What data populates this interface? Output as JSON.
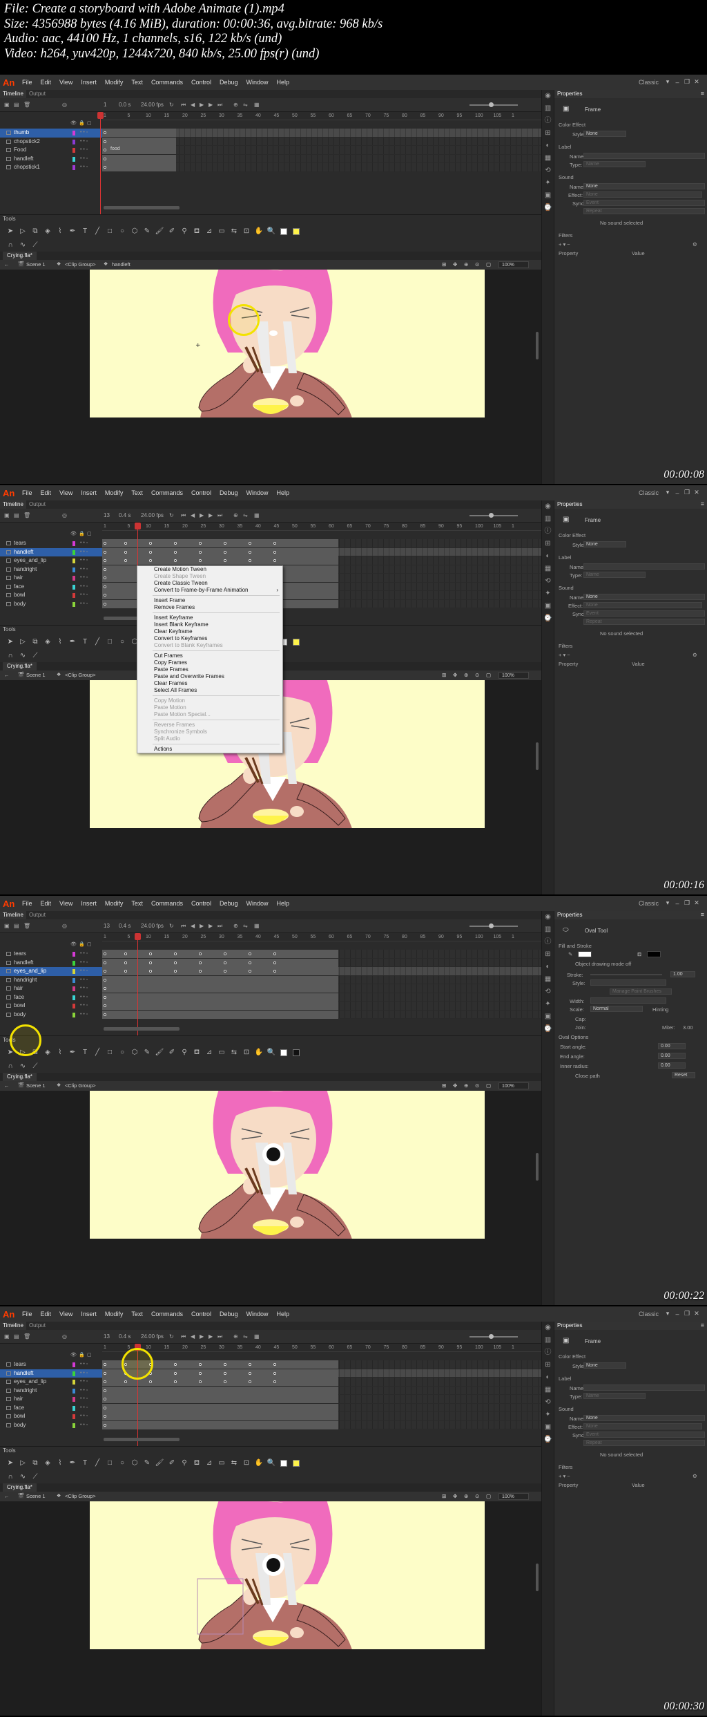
{
  "meta": {
    "file": "File: Create a storyboard with Adobe Animate (1).mp4",
    "size": "Size: 4356988 bytes (4.16 MiB), duration: 00:00:36, avg.bitrate: 968 kb/s",
    "audio": "Audio: aac, 44100 Hz, 1 channels, s16, 122 kb/s (und)",
    "video": "Video: h264, yuv420p, 1244x720, 840 kb/s, 25.00 fps(r) (und)"
  },
  "app": {
    "logo": "An",
    "menus": [
      "File",
      "Edit",
      "View",
      "Insert",
      "Modify",
      "Text",
      "Commands",
      "Control",
      "Debug",
      "Window",
      "Help"
    ],
    "workspace": "Classic",
    "panel_tabs": [
      "Timeline",
      "Output"
    ],
    "tools_title": "Tools",
    "properties_tab": "Properties",
    "colors": {
      "accent": "#2e5fa8",
      "logo": "#ff3c00",
      "highlight": "#f3e200",
      "stage": "#fdfdc8"
    }
  },
  "frames": [
    {
      "timestamp": "00:00:08",
      "fps": "24.00 fps",
      "frame_num": "1",
      "time": "0.0 s",
      "layers": [
        {
          "name": "thumb",
          "color": "#d43ad4",
          "selected": true
        },
        {
          "name": "chopstick2",
          "color": "#8a3ad4",
          "selected": false
        },
        {
          "name": "Food",
          "color": "#d43a3a",
          "selected": false
        },
        {
          "name": "handleft",
          "color": "#3ad4d4",
          "selected": false
        },
        {
          "name": "chopstick1",
          "color": "#a03ad4",
          "selected": false
        }
      ],
      "frame_label": "food",
      "doc_tab": "Crying.fla*",
      "breadcrumb": [
        "Scene 1",
        "<Clip Group>",
        "handleft"
      ],
      "zoom": "100%",
      "props_title": "Frame",
      "props": {
        "color_effect": "Color Effect",
        "style_label": "Style:",
        "style_value": "None",
        "label_section": "Label",
        "name_label": "Name:",
        "type_label": "Type:",
        "type_value": "Name",
        "sound_section": "Sound",
        "sound_name": "None",
        "effect_label": "Effect:",
        "effect_value": "None",
        "sync_label": "Sync:",
        "sync_value": "Event",
        "repeat_value": "Repeat",
        "no_sound": "No sound selected",
        "filters_section": "Filters",
        "property_col": "Property",
        "value_col": "Value"
      }
    },
    {
      "timestamp": "00:00:16",
      "fps": "24.00 fps",
      "frame_num": "13",
      "time": "0.4 s",
      "layers": [
        {
          "name": "tears",
          "color": "#d43ad4",
          "selected": false
        },
        {
          "name": "handleft",
          "color": "#3ad43a",
          "selected": true
        },
        {
          "name": "eyes_and_lip",
          "color": "#d4d43a",
          "selected": false
        },
        {
          "name": "handright",
          "color": "#3a8ad4",
          "selected": false
        },
        {
          "name": "hair",
          "color": "#d43a8a",
          "selected": false
        },
        {
          "name": "face",
          "color": "#3ad4d4",
          "selected": false
        },
        {
          "name": "bowl",
          "color": "#d43a3a",
          "selected": false
        },
        {
          "name": "body",
          "color": "#8ad43a",
          "selected": false
        }
      ],
      "doc_tab": "Crying.fla*",
      "breadcrumb": [
        "Scene 1",
        "<Clip Group>"
      ],
      "zoom": "100%",
      "props_title": "Frame",
      "context_menu": [
        {
          "label": "Create Motion Tween",
          "disabled": false
        },
        {
          "label": "Create Shape Tween",
          "disabled": true
        },
        {
          "label": "Create Classic Tween",
          "disabled": false
        },
        {
          "label": "Convert to Frame-by-Frame Animation",
          "disabled": false,
          "submenu": true
        },
        {
          "sep": true
        },
        {
          "label": "Insert Frame",
          "disabled": false
        },
        {
          "label": "Remove Frames",
          "disabled": false
        },
        {
          "sep": true
        },
        {
          "label": "Insert Keyframe",
          "disabled": false
        },
        {
          "label": "Insert Blank Keyframe",
          "disabled": false
        },
        {
          "label": "Clear Keyframe",
          "disabled": false
        },
        {
          "label": "Convert to Keyframes",
          "disabled": false
        },
        {
          "label": "Convert to Blank Keyframes",
          "disabled": true
        },
        {
          "sep": true
        },
        {
          "label": "Cut Frames",
          "disabled": false
        },
        {
          "label": "Copy Frames",
          "disabled": false
        },
        {
          "label": "Paste Frames",
          "disabled": false
        },
        {
          "label": "Paste and Overwrite Frames",
          "disabled": false
        },
        {
          "label": "Clear Frames",
          "disabled": false
        },
        {
          "label": "Select All Frames",
          "disabled": false
        },
        {
          "sep": true
        },
        {
          "label": "Copy Motion",
          "disabled": true
        },
        {
          "label": "Paste Motion",
          "disabled": true
        },
        {
          "label": "Paste Motion Special...",
          "disabled": true
        },
        {
          "sep": true
        },
        {
          "label": "Reverse Frames",
          "disabled": true
        },
        {
          "label": "Synchronize Symbols",
          "disabled": true
        },
        {
          "label": "Split Audio",
          "disabled": true
        },
        {
          "sep": true
        },
        {
          "label": "Actions",
          "disabled": false
        }
      ],
      "props": {
        "color_effect": "Color Effect",
        "style_label": "Style:",
        "style_value": "None",
        "label_section": "Label",
        "name_label": "Name:",
        "type_label": "Type:",
        "type_value": "Name",
        "sound_section": "Sound",
        "sound_name": "None",
        "effect_label": "Effect:",
        "effect_value": "None",
        "sync_label": "Sync:",
        "sync_value": "Event",
        "repeat_value": "Repeat",
        "no_sound": "No sound selected",
        "filters_section": "Filters",
        "property_col": "Property",
        "value_col": "Value"
      }
    },
    {
      "timestamp": "00:00:22",
      "fps": "24.00 fps",
      "frame_num": "13",
      "time": "0.4 s",
      "layers": [
        {
          "name": "tears",
          "color": "#d43ad4",
          "selected": false
        },
        {
          "name": "handleft",
          "color": "#3ad43a",
          "selected": false
        },
        {
          "name": "eyes_and_lip",
          "color": "#d4d43a",
          "selected": true
        },
        {
          "name": "handright",
          "color": "#3a8ad4",
          "selected": false
        },
        {
          "name": "hair",
          "color": "#d43a8a",
          "selected": false
        },
        {
          "name": "face",
          "color": "#3ad4d4",
          "selected": false
        },
        {
          "name": "bowl",
          "color": "#d43a3a",
          "selected": false
        },
        {
          "name": "body",
          "color": "#8ad43a",
          "selected": false
        }
      ],
      "doc_tab": "Crying.fla*",
      "breadcrumb": [
        "Scene 1",
        "<Clip Group>"
      ],
      "zoom": "100%",
      "props_title": "Oval Tool",
      "oval": {
        "fill_stroke": "Fill and Stroke",
        "object_drawing": "Object drawing mode off",
        "stroke_label": "Stroke:",
        "stroke_value": "1.00",
        "style_label": "Style:",
        "manage_brush": "Manage Paint Brushes",
        "width_label": "Width:",
        "scale_label": "Scale:",
        "scale_value": "Normal",
        "hinting": "Hinting",
        "cap_label": "Cap:",
        "join_label": "Join:",
        "miter_label": "Miter:",
        "miter_value": "3.00",
        "oval_options": "Oval Options",
        "start_angle": "Start angle:",
        "start_value": "0.00",
        "end_angle": "End angle:",
        "end_value": "0.00",
        "inner_radius": "Inner radius:",
        "inner_value": "0.00",
        "close_path": "Close path",
        "reset": "Reset"
      }
    },
    {
      "timestamp": "00:00:30",
      "fps": "24.00 fps",
      "frame_num": "13",
      "time": "0.4 s",
      "layers": [
        {
          "name": "tears",
          "color": "#d43ad4",
          "selected": false
        },
        {
          "name": "handleft",
          "color": "#3ad43a",
          "selected": true
        },
        {
          "name": "eyes_and_lip",
          "color": "#d4d43a",
          "selected": false
        },
        {
          "name": "handright",
          "color": "#3a8ad4",
          "selected": false
        },
        {
          "name": "hair",
          "color": "#d43a8a",
          "selected": false
        },
        {
          "name": "face",
          "color": "#3ad4d4",
          "selected": false
        },
        {
          "name": "bowl",
          "color": "#d43a3a",
          "selected": false
        },
        {
          "name": "body",
          "color": "#8ad43a",
          "selected": false
        }
      ],
      "doc_tab": "Crying.fla*",
      "breadcrumb": [
        "Scene 1",
        "<Clip Group>"
      ],
      "zoom": "100%",
      "props_title": "Frame",
      "props": {
        "color_effect": "Color Effect",
        "style_label": "Style:",
        "style_value": "None",
        "label_section": "Label",
        "name_label": "Name:",
        "type_label": "Type:",
        "type_value": "Name",
        "sound_section": "Sound",
        "sound_name": "None",
        "effect_label": "Effect:",
        "effect_value": "None",
        "sync_label": "Sync:",
        "sync_value": "Event",
        "repeat_value": "Repeat",
        "no_sound": "No sound selected",
        "filters_section": "Filters",
        "property_col": "Property",
        "value_col": "Value"
      }
    }
  ],
  "ruler_ticks": [
    "1",
    "5",
    "10",
    "15",
    "20",
    "25",
    "30",
    "35",
    "40",
    "45",
    "50",
    "55",
    "60",
    "65",
    "70",
    "75",
    "80",
    "85",
    "90",
    "95",
    "100",
    "105",
    "1"
  ]
}
